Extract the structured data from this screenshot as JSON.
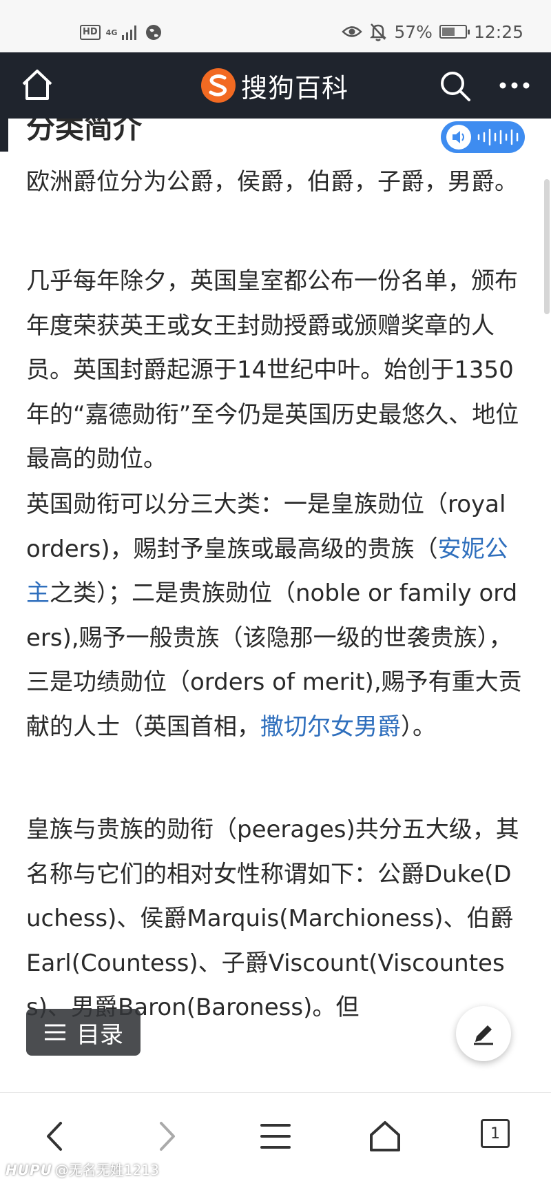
{
  "status_bar": {
    "hd": "HD",
    "network": "4G",
    "battery_percent": "57%",
    "battery_level": 0.57,
    "time": "12:25"
  },
  "header": {
    "logo_text": "搜狗百科",
    "logo_color": "#f26a22"
  },
  "article": {
    "section_title": "分类简介",
    "paragraphs": {
      "p1": "欧洲爵位分为公爵，侯爵，伯爵，子爵，男爵。",
      "p2": "几乎每年除夕，英国皇室都公布一份名单，颁布年度荣获英王或女王封勋授爵或颁赠奖章的人员。英国封爵起源于14世纪中叶。始创于1350年的“嘉德勋衔”至今仍是英国历史最悠久、地位最高的勋位。",
      "p3_a": "英国勋衔可以分三大类：一是皇族勋位（royal orders)，赐封予皇族或最高级的贵族（",
      "p3_link1": "安妮公主",
      "p3_b": "之类）；二是贵族勋位（noble or family orders),赐予一般贵族（该隐那一级的世袭贵族），三是功绩勋位（orders of merit),赐予有重大贡献的人士（英国首相，",
      "p3_link2": "撒切尔女男爵",
      "p3_c": "）。",
      "p4": "皇族与贵族的勋衔（peerages)共分五大级，其名称与它们的相对女性称谓如下：公爵Duke(Duchess)、侯爵Marquis(Marchioness)、伯爵Earl(Countess)、子爵Viscount(Viscountess)、男爵Baron(Baroness)。但"
    }
  },
  "floating": {
    "toc_label": "目录"
  },
  "browser_nav": {
    "tab_count": "1"
  },
  "watermark": {
    "brand": "HUPU",
    "user": "@无名无姓1213"
  },
  "colors": {
    "header_bg": "#1f242d",
    "link": "#2f6fbd",
    "audio_button": "#3e8cf0"
  }
}
